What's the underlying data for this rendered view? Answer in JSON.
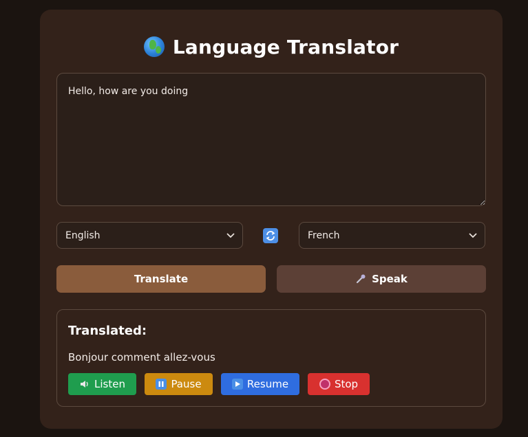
{
  "app": {
    "title": "Language Translator",
    "title_icon": "globe-icon"
  },
  "input": {
    "value": "Hello, how are you doing"
  },
  "languages": {
    "source": "English",
    "target": "French",
    "swap_icon": "swap-arrows-icon"
  },
  "actions": {
    "translate_label": "Translate",
    "speak_label": "Speak",
    "speak_icon": "microphone-icon"
  },
  "result": {
    "heading": "Translated:",
    "text": "Bonjour comment allez-vous",
    "controls": {
      "listen_label": "Listen",
      "pause_label": "Pause",
      "resume_label": "Resume",
      "stop_label": "Stop"
    }
  },
  "colors": {
    "background": "#1b1410",
    "card": "#33221a",
    "translate_button": "#8a5c3c",
    "speak_button": "#5c4036",
    "listen_button": "#1f9d4e",
    "pause_button": "#cc8a0f",
    "resume_button": "#2f6de0",
    "stop_button": "#d8312f"
  }
}
